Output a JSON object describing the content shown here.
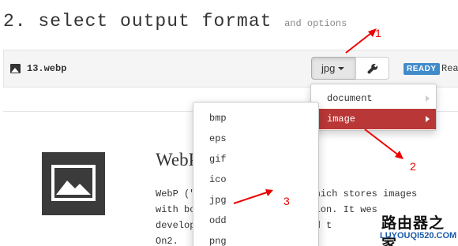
{
  "heading": {
    "title": "2. select output format",
    "subtitle": "and options"
  },
  "file": {
    "name": "13.webp",
    "format_selected": "jpg",
    "status_badge": "READY",
    "status_text": "Rea"
  },
  "preview": {
    "title": "WebP",
    "description_lines": [
      "WebP (\"                 at which stores images",
      "with bo             compression. It wes",
      "develop              acquired t",
      "On2."
    ]
  },
  "format_menu": {
    "items": [
      {
        "label": "document",
        "active": false
      },
      {
        "label": "image",
        "active": true
      }
    ]
  },
  "image_formats": [
    "bmp",
    "eps",
    "gif",
    "ico",
    "jpg",
    "odd",
    "png"
  ],
  "annotations": [
    "1",
    "2",
    "3"
  ],
  "watermark": {
    "cn": "路由器之家",
    "en": "LUYOUQI520.COM"
  },
  "colors": {
    "accent_red": "#b93737",
    "badge_blue": "#428bca",
    "annotation_red": "#ee0000"
  }
}
